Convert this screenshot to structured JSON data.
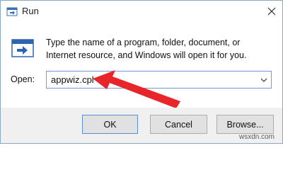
{
  "window": {
    "title": "Run",
    "description": "Type the name of a program, folder, document, or Internet resource, and Windows will open it for you.",
    "open_label": "Open:",
    "command_value": "appwiz.cpl"
  },
  "buttons": {
    "ok": "OK",
    "cancel": "Cancel",
    "browse": "Browse..."
  },
  "icons": {
    "title": "run-icon",
    "content": "run-icon",
    "close": "close-icon",
    "dropdown": "chevron-down-icon",
    "annotation": "red-arrow-annotation"
  },
  "colors": {
    "annotation_arrow": "#e8262a",
    "focus_border": "#7a9bd1",
    "button_bar": "#f0f0f0"
  },
  "watermark": "wsxdn.com"
}
